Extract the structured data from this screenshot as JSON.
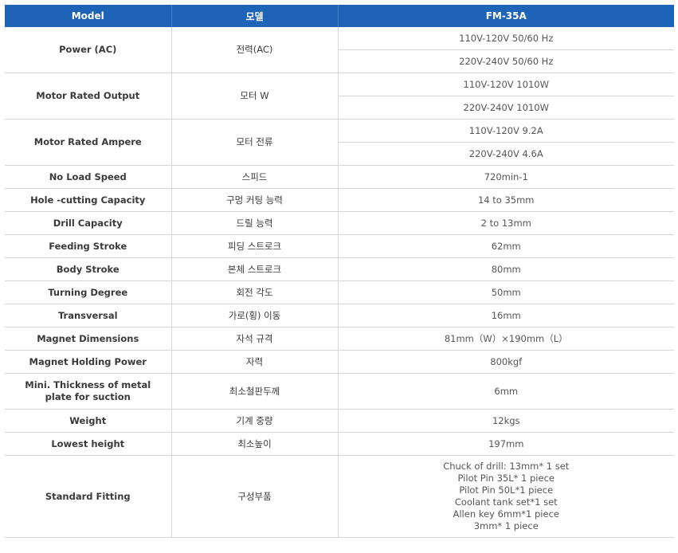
{
  "header": {
    "col_model": "Model",
    "col_korean": "모델",
    "col_value": "FM-35A"
  },
  "rows": [
    {
      "label": "Power (AC)",
      "kr": "전력(AC)",
      "values": [
        "110V-120V 50/60 Hz",
        "220V-240V 50/60 Hz"
      ]
    },
    {
      "label": "Motor Rated Output",
      "kr": "모터 W",
      "values": [
        "110V-120V 1010W",
        "220V-240V 1010W"
      ]
    },
    {
      "label": "Motor Rated Ampere",
      "kr": "모터 전류",
      "values": [
        "110V-120V 9.2A",
        "220V-240V 4.6A"
      ]
    },
    {
      "label": "No Load Speed",
      "kr": "스피드",
      "value": "720min-1"
    },
    {
      "label": "Hole -cutting Capacity",
      "kr": "구멍 커팅 능력",
      "value": "14 to 35mm"
    },
    {
      "label": "Drill Capacity",
      "kr": "드릴 능력",
      "value": "2 to 13mm"
    },
    {
      "label": "Feeding Stroke",
      "kr": "피딩 스트로크",
      "value": "62mm"
    },
    {
      "label": "Body Stroke",
      "kr": "본체 스트로크",
      "value": "80mm"
    },
    {
      "label": "Turning Degree",
      "kr": "회전 각도",
      "value": "50mm"
    },
    {
      "label": "Transversal",
      "kr": "가로(횡) 이동",
      "value": "16mm"
    },
    {
      "label": "Magnet Dimensions",
      "kr": "자석 규격",
      "value": "81mm（W）×190mm（L）"
    },
    {
      "label": "Magnet Holding Power",
      "kr": "자력",
      "value": "800kgf"
    },
    {
      "label_lines": [
        "Mini. Thickness of metal",
        "plate for suction"
      ],
      "kr": "최소철판두께",
      "value": "6mm"
    },
    {
      "label": "Weight",
      "kr": "기계 중량",
      "value": "12kgs"
    },
    {
      "label": "Lowest height",
      "kr": "최소높이",
      "value": "197mm"
    },
    {
      "label": "Standard Fitting",
      "kr": "구성부품",
      "value_lines": [
        "Chuck of drill: 13mm* 1 set",
        "Pilot Pin 35L* 1 piece",
        "Pilot Pin 50L*1 piece",
        "Coolant tank set*1 set",
        "Allen key 6mm*1 piece",
        "3mm* 1 piece"
      ]
    }
  ]
}
